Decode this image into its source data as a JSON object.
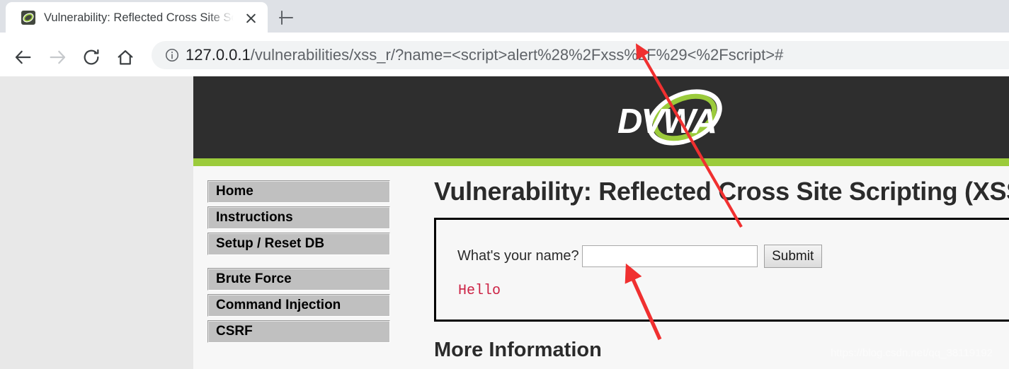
{
  "browser": {
    "tab": {
      "title": "Vulnerability: Reflected Cross Site Scripting (XSS) :: Damn Vulnerable Web Application (DVWA) v1.10 *Development*",
      "favicon_name": "dvwa-favicon",
      "close_label": "Close tab"
    },
    "new_tab_label": "New Tab",
    "nav": {
      "back_label": "Back",
      "forward_label": "Forward",
      "reload_label": "Reload",
      "home_label": "Home"
    },
    "omnibox": {
      "site_info_label": "View site information",
      "url_host": "127.0.0.1",
      "url_path": "/vulnerabilities/xss_r/?name=<script>alert%28%2Fxss%2F%29<%2Fscript>#",
      "full_url": "127.0.0.1/vulnerabilities/xss_r/?name=<script>alert%28%2Fxss%2F%29<%2Fscript>#"
    }
  },
  "site": {
    "logo_text": "DVWA",
    "colors": {
      "header_bg": "#2e2e2e",
      "accent_green": "#9bcb3b",
      "page_bg": "#f7f7f7",
      "outer_bg": "#e8e8e8",
      "hello_red": "#cc2244"
    },
    "sidebar": {
      "groups": [
        {
          "items": [
            {
              "label": "Home"
            },
            {
              "label": "Instructions"
            },
            {
              "label": "Setup / Reset DB"
            }
          ]
        },
        {
          "items": [
            {
              "label": "Brute Force"
            },
            {
              "label": "Command Injection"
            },
            {
              "label": "CSRF"
            }
          ]
        }
      ]
    },
    "main": {
      "page_title": "Vulnerability: Reflected Cross Site Scripting (XSS)",
      "form": {
        "label": "What's your name?",
        "input_value": "",
        "input_placeholder": "",
        "submit_label": "Submit"
      },
      "output_text": "Hello",
      "more_info_heading": "More Information"
    }
  },
  "annotations": {
    "watermark": "https://blog.csdn.net/qq_38119192",
    "arrows": [
      {
        "name": "arrow-to-url-bar",
        "color": "#f03030"
      },
      {
        "name": "arrow-to-name-input",
        "color": "#f03030"
      }
    ]
  }
}
